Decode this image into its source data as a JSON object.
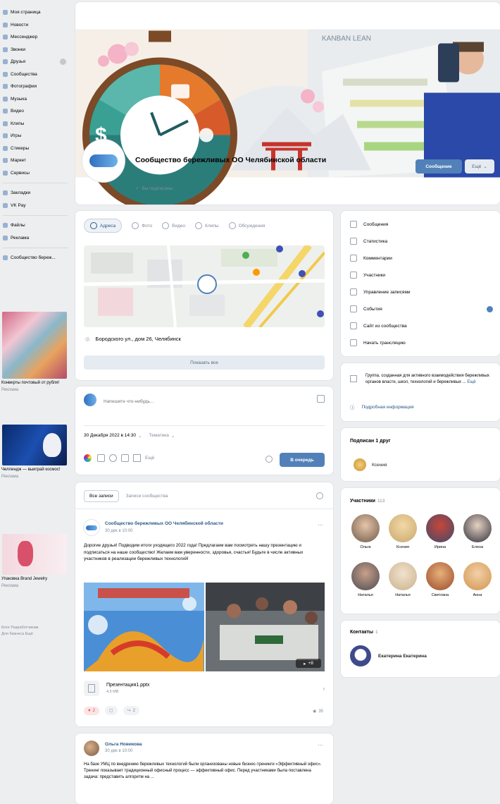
{
  "left_nav": {
    "items": [
      {
        "label": "Моя страница"
      },
      {
        "label": "Новости"
      },
      {
        "label": "Мессенджер"
      },
      {
        "label": "Звонки"
      },
      {
        "label": "Друзья"
      },
      {
        "label": "Сообщества"
      },
      {
        "label": "Фотографии"
      },
      {
        "label": "Музыка"
      },
      {
        "label": "Видео"
      },
      {
        "label": "Клипы"
      },
      {
        "label": "Игры"
      },
      {
        "label": "Стикеры"
      },
      {
        "label": "Маркет"
      },
      {
        "label": "Сервисы"
      }
    ],
    "items2": [
      {
        "label": "Закладки"
      },
      {
        "label": "VK Pay"
      }
    ],
    "items3": [
      {
        "label": "Файлы"
      },
      {
        "label": "Реклама"
      }
    ],
    "items4": [
      {
        "label": "Сообщество береж..."
      }
    ],
    "ads": [
      {
        "title": "Конверты почтовый от рубля!",
        "sub": "Реклама"
      },
      {
        "title": "Челлендж — выиграй космос!",
        "sub": "Реклама"
      },
      {
        "title": "Упаковка Brand Jewelry",
        "sub": "Реклама"
      }
    ],
    "footer": [
      "Блог",
      "Разработчикам",
      "Для бизнеса",
      "Ещё"
    ]
  },
  "header": {
    "community_name": "Сообщество бережливых ОО Челябинской области",
    "subscribed_label": "Вы подписаны",
    "message_button": "Сообщение",
    "more_button": "Ещё",
    "cover_text": "KANBAN LEAN"
  },
  "info_tabs": [
    "Адреса",
    "Фото",
    "Видео",
    "Клипы",
    "Обсуждения"
  ],
  "address": {
    "text": "Бородского ул., дом 26, Челябинск",
    "show_all": "Показать все"
  },
  "composer": {
    "placeholder": "Напишите что-нибудь...",
    "date": "30 Декабря 2022 в 14:30",
    "topic": "Тематика",
    "more": "Ещё",
    "submit": "В очередь"
  },
  "wall_tabs": {
    "all": "Все записи",
    "community": "Записи сообщества"
  },
  "post1": {
    "author": "Сообщество бережливых ОО Челябинской области",
    "time": "30 дек в 10:00",
    "text": "Дорогие друзья! Подводим итоги уходящего 2022 года! Предлагаем вам посмотреть нашу презентацию и подписаться на наше сообщество! Желаем вам уверенности, здоровья, счастья! Будьте в числе активных участников в реализации бережливых технологий!",
    "attachment_name": "Презентация1.pptx",
    "attachment_size": "4,5 MB",
    "photo_count": "+8",
    "likes": "2",
    "reposts": "2",
    "views": "35"
  },
  "post2": {
    "author": "Ольга Новикова",
    "time": "30 дек в 10:00",
    "text": "На базе УМЦ по внедрению бережливых технологий были организованы новые бизнес-тренинги «Эффективный офис». Тренинг показывает традиционный офисный процесс — эффективный офис. Перед участниками была поставлена задача: представить алгоритм на ..."
  },
  "right_menu": [
    "Сообщения",
    "Статистика",
    "Комментарии",
    "Участники",
    "Управление записями",
    "События",
    "Сайт из сообщества",
    "Начать трансляцию"
  ],
  "about": {
    "text": "Группа, созданная для активного взаимодействия бережливых органов власти, школ, технологий и бережливых ...",
    "more": "Ещё",
    "info": "Подробная информация"
  },
  "friends": {
    "title": "Подписан 1 друг",
    "name": "Ксения"
  },
  "members": {
    "title": "Участники",
    "count": "113",
    "list": [
      "Ольга",
      "Ксения",
      "Ирина",
      "Елена",
      "Наталья",
      "Наталья",
      "Светлана",
      "Анна"
    ]
  },
  "contacts": {
    "title": "Контакты",
    "count": "1",
    "name": "Екатерина Екатерина"
  }
}
